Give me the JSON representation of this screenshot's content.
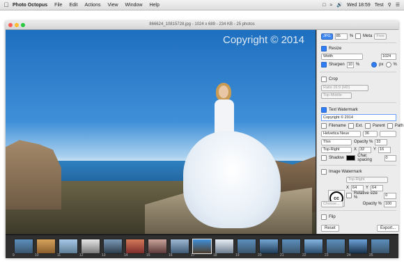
{
  "menubar": {
    "app_name": "Photo Octopus",
    "items": [
      "File",
      "Edit",
      "Actions",
      "View",
      "Window",
      "Help"
    ],
    "clock": "Wed 18:59",
    "user": "Test"
  },
  "window": {
    "title": "866624_10815728.jpg - 1024 x 689 - 234 KB - 25 photos"
  },
  "photo": {
    "watermark_text": "Copyright © 2014"
  },
  "panel": {
    "format": {
      "value": "JPG",
      "quality": "85",
      "percent": "%",
      "meta_label": "Meta",
      "meta_value": "Free"
    },
    "resize": {
      "label": "Resize",
      "mode": "Width",
      "value": "1024"
    },
    "sharpen": {
      "label": "Sharpen",
      "amount": "10",
      "percent": "%",
      "px_label": "px",
      "pct_label": "%"
    },
    "crop": {
      "label": "Crop",
      "ratio": "Ratio 16:9 (HD)",
      "position": "Top-Middle"
    },
    "text_watermark": {
      "label": "Text Watermark",
      "text": "Copyright © 2014",
      "options": [
        "Filename",
        "Ext.",
        "Parent",
        "Path"
      ],
      "font": "Helvetica Neue",
      "size": "36",
      "weight": "Thin",
      "opacity_label": "Opacity %",
      "opacity": "33",
      "position": "Top-Right",
      "x_label": "X",
      "x": "32",
      "y_label": "Y",
      "y": "16",
      "shadow_label": "Shadow",
      "char_spacing_label": "Char. spacing",
      "char_spacing": "0"
    },
    "image_watermark": {
      "label": "Image Watermark",
      "position": "Top-Right",
      "x_label": "X",
      "x": "64",
      "y_label": "Y",
      "y": "64",
      "relative_label": "Relative size %",
      "relative": "0",
      "choose_label": "Choose...",
      "opacity_label": "Opacity %",
      "opacity": "100",
      "icon_text": "cc"
    },
    "flip": {
      "label": "Flip"
    },
    "reset_label": "Reset",
    "export_label": "Export..."
  },
  "filmstrip": {
    "labels": [
      "9",
      "10",
      "11",
      "12",
      "13",
      "14",
      "15",
      "16",
      "17",
      "18",
      "19",
      "20",
      "21",
      "22",
      "23",
      "24",
      "25"
    ]
  }
}
